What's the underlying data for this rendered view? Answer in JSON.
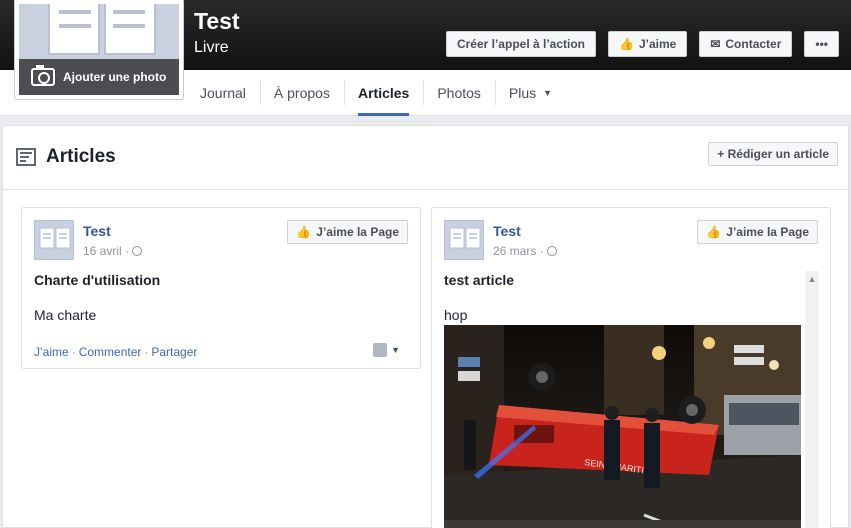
{
  "header": {
    "page_name": "Test",
    "page_category": "Livre",
    "add_photo_label": "Ajouter une photo",
    "buttons": {
      "cta": "Créer l’appel à l’action",
      "like": "J’aime",
      "contact": "Contacter",
      "more": "•••"
    }
  },
  "nav": {
    "tabs": [
      {
        "label": "Journal"
      },
      {
        "label": "À propos"
      },
      {
        "label": "Articles"
      },
      {
        "label": "Photos"
      },
      {
        "label": "Plus"
      }
    ],
    "active": "Articles"
  },
  "articles": {
    "title": "Articles",
    "write_button": "+ Rédiger un article",
    "cards": [
      {
        "author": "Test",
        "date": "16 avril ·",
        "like_page": "J’aime la Page",
        "title": "Charte d'utilisation",
        "body": "Ma charte",
        "actions": {
          "like": "J’aime",
          "comment": "Commenter",
          "share": "Partager"
        }
      },
      {
        "author": "Test",
        "date": "26 mars ·",
        "like_page": "J’aime la Page",
        "title": "test article",
        "body": "hop"
      }
    ]
  },
  "colors": {
    "link": "#365899",
    "accent": "#4267b2",
    "cover_dark": "#1a1a1a",
    "background": "#e9ebee"
  }
}
